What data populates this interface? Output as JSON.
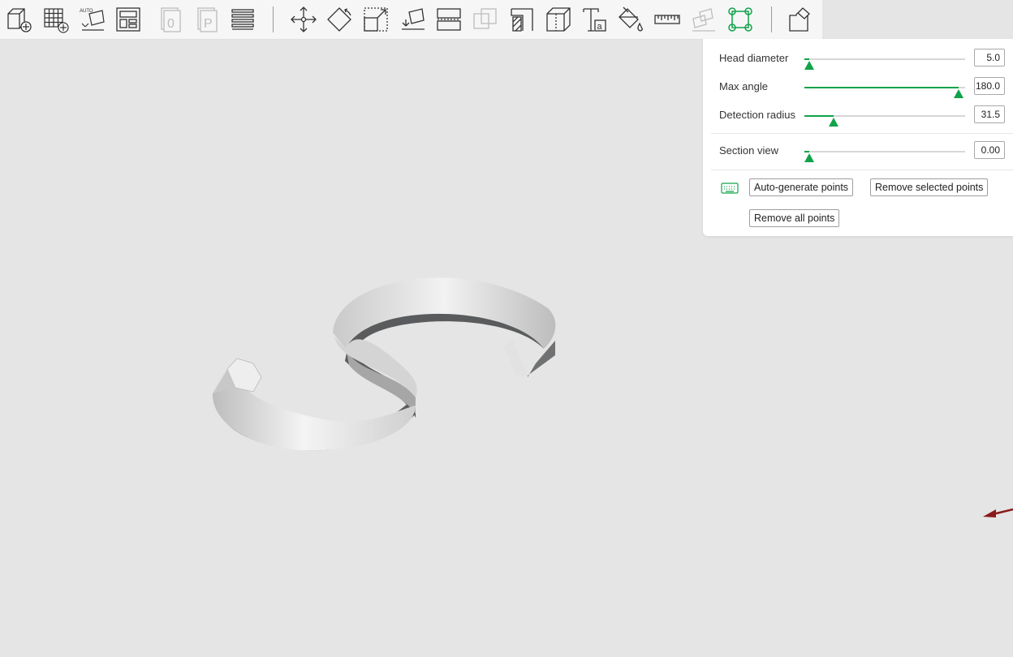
{
  "toolbar": {
    "icons": [
      "add-object-icon",
      "add-plate-icon",
      "auto-orient-icon",
      "arrange-icon",
      "add-plate-copy-icon",
      "plate-p-icon",
      "layers-icon",
      "move-icon",
      "rotate-icon",
      "scale-icon",
      "lay-on-face-icon",
      "cut-icon",
      "boolean-icon",
      "support-paint-icon",
      "seam-paint-icon",
      "text-icon",
      "color-paint-icon",
      "measure-icon",
      "assembly-icon",
      "brim-ears-icon",
      "split-to-parts-icon"
    ],
    "active_tool": "brim-ears-icon"
  },
  "panel": {
    "head_diameter": {
      "label": "Head diameter",
      "value": "5.0",
      "fraction": 0.03
    },
    "max_angle": {
      "label": "Max angle",
      "value": "180.0",
      "fraction": 0.96
    },
    "detection_radius": {
      "label": "Detection radius",
      "value": "31.5",
      "fraction": 0.18
    },
    "section_view": {
      "label": "Section view",
      "value": "0.00",
      "fraction": 0.03
    },
    "buttons": {
      "auto_generate": "Auto-generate points",
      "remove_selected": "Remove selected points",
      "remove_all": "Remove all points"
    },
    "keyboard_icon": "keyboard-icon"
  },
  "colors": {
    "accent": "#10a34a",
    "canvas_background": "#e5e5e5",
    "model_top": "#e8e8e8",
    "model_side": "#5a5b5c",
    "axis_x": "#8b1a1a"
  }
}
